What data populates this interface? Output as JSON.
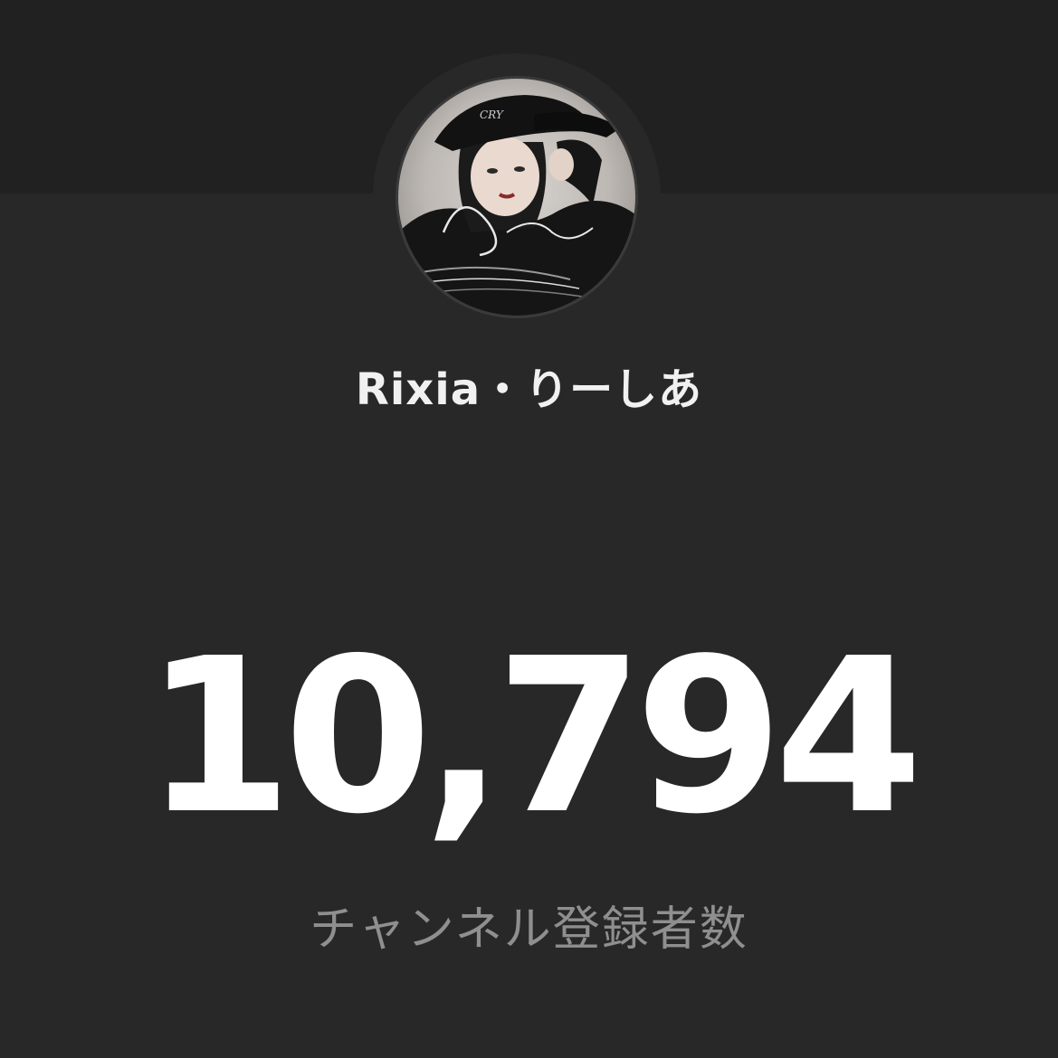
{
  "channel": {
    "name": "Rixia・りーしあ",
    "avatar": "channel-avatar-photo"
  },
  "stats": {
    "subscriber_count": "10,794",
    "subscriber_label": "チャンネル登録者数"
  },
  "colors": {
    "background": "#282828",
    "top_band": "#212121",
    "count_text": "#ffffff",
    "label_text": "#8f8f8f"
  }
}
